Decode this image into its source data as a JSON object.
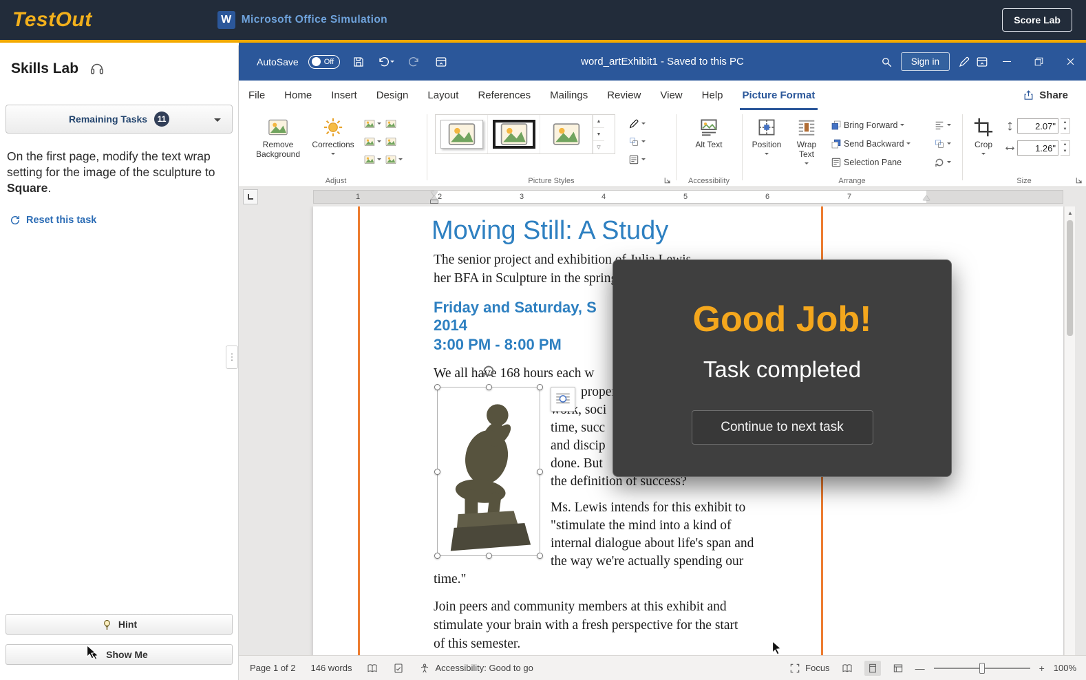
{
  "header": {
    "brand": "TestOut",
    "app_name": "Microsoft Office Simulation",
    "score_button": "Score Lab"
  },
  "sidebar": {
    "title": "Skills Lab",
    "remaining_tasks": "Remaining Tasks",
    "badge": "11",
    "task_prefix": "On the first page, modify the text wrap setting for the image of the sculpture to ",
    "task_emphasis": "Square",
    "task_suffix": ".",
    "reset_link": "Reset this task",
    "hint": "Hint",
    "show_me": "Show Me"
  },
  "titlebar": {
    "autosave": "AutoSave",
    "autosave_state": "Off",
    "doc_title": "word_artExhibit1 - Saved to this PC",
    "sign_in": "Sign in"
  },
  "tabs": {
    "items": [
      "File",
      "Home",
      "Insert",
      "Design",
      "Layout",
      "References",
      "Mailings",
      "Review",
      "View",
      "Help",
      "Picture Format"
    ],
    "share": "Share"
  },
  "ribbon": {
    "remove_background": "Remove Background",
    "corrections": "Corrections",
    "adjust_label": "Adjust",
    "picture_styles_label": "Picture Styles",
    "alt_text": "Alt Text",
    "accessibility_label": "Accessibility",
    "position": "Position",
    "wrap_text": "Wrap Text",
    "bring_forward": "Bring Forward",
    "send_backward": "Send Backward",
    "selection_pane": "Selection Pane",
    "arrange_label": "Arrange",
    "crop": "Crop",
    "height_value": "2.07\"",
    "width_value": "1.26\"",
    "size_label": "Size"
  },
  "ruler": {
    "numbers": [
      "1",
      "2",
      "3",
      "4",
      "5",
      "6",
      "7"
    ]
  },
  "document": {
    "title": "Moving Still: A Study",
    "intro1": "The senior project and exhibition of Julia Lewis",
    "intro2": "her BFA in Sculpture in the spring",
    "event1": "Friday and Saturday, S",
    "event2": "2014",
    "event3": "3:00 PM - 8:00 PM",
    "hours": "We all have 168 hours each w",
    "wrap1": "proper",
    "wrap2": "work, soci",
    "wrap3": "time, succ",
    "wrap4": "and discip",
    "wrap5": "done. But",
    "wrap6": "the definition of success?",
    "quote1": "Ms. Lewis intends for this exhibit to",
    "quote2": "\"stimulate the mind into a kind of",
    "quote3": "internal dialogue about life's span and",
    "quote4": "the way we're actually spending our",
    "quote5": "time.\"",
    "close1": "Join peers and community members at this exhibit and",
    "close2": "stimulate your brain with a fresh perspective for the start",
    "close3": "of this semester."
  },
  "modal": {
    "title": "Good Job!",
    "subtitle": "Task completed",
    "button": "Continue to next task"
  },
  "statusbar": {
    "page": "Page 1 of 2",
    "words": "146 words",
    "accessibility": "Accessibility: Good to go",
    "focus": "Focus",
    "zoom": "100%"
  }
}
